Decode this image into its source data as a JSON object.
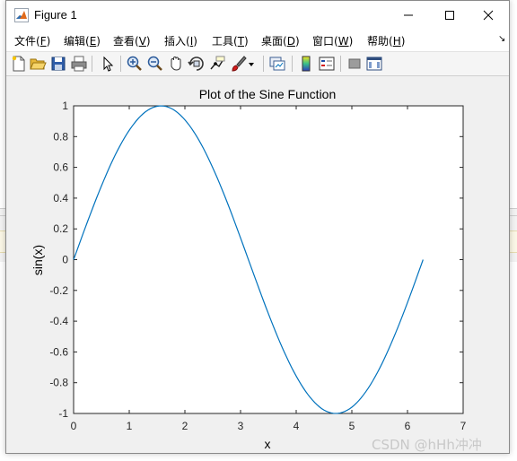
{
  "window": {
    "title": "Figure 1"
  },
  "menu": {
    "items": [
      {
        "label": "文件(F)",
        "text": "文件(",
        "key": "F"
      },
      {
        "label": "编辑(E)",
        "text": "编辑(",
        "key": "E"
      },
      {
        "label": "查看(V)",
        "text": "查看(",
        "key": "V"
      },
      {
        "label": "插入(I)",
        "text": "插入(",
        "key": "I"
      },
      {
        "label": "工具(T)",
        "text": "工具(",
        "key": "T"
      },
      {
        "label": "桌面(D)",
        "text": "桌面(",
        "key": "D"
      },
      {
        "label": "窗口(W)",
        "text": "窗口(",
        "key": "W"
      },
      {
        "label": "帮助(H)",
        "text": "帮助(",
        "key": "H"
      }
    ],
    "dock_icon": "dock-arrow-icon"
  },
  "toolbar": {
    "icons": [
      "new-figure-icon",
      "open-file-icon",
      "save-icon",
      "print-icon",
      "select-pointer-icon",
      "zoom-in-icon",
      "zoom-out-icon",
      "pan-hand-icon",
      "rotate-3d-icon",
      "data-cursor-icon",
      "brush-icon",
      "brush-dropdown-icon",
      "link-plot-icon",
      "insert-colorbar-icon",
      "insert-legend-icon",
      "hide-plot-tools-icon",
      "show-plot-tools-icon"
    ]
  },
  "colors": {
    "line": "#0072BD",
    "figure_bg": "#f0f0f0",
    "axes_bg": "#ffffff"
  },
  "chart_data": {
    "type": "line",
    "title": "Plot of the Sine Function",
    "xlabel": "x",
    "ylabel": "sin(x)",
    "xlim": [
      0,
      7
    ],
    "ylim": [
      -1,
      1
    ],
    "xticks": [
      0,
      1,
      2,
      3,
      4,
      5,
      6,
      7
    ],
    "yticks": [
      -1,
      -0.8,
      -0.6,
      -0.4,
      -0.2,
      0,
      0.2,
      0.4,
      0.6,
      0.8,
      1
    ],
    "ytick_labels": [
      "-1",
      "-0.8",
      "-0.6",
      "-0.4",
      "-0.2",
      "0",
      "0.2",
      "0.4",
      "0.6",
      "0.8",
      "1"
    ],
    "grid": false,
    "series": [
      {
        "x": [
          0,
          0.25,
          0.5,
          0.75,
          1.0,
          1.25,
          1.5,
          1.75,
          2.0,
          2.25,
          2.5,
          2.75,
          3.0,
          3.25,
          3.5,
          3.75,
          4.0,
          4.25,
          4.5,
          4.75,
          5.0,
          5.25,
          5.5,
          5.75,
          6.0,
          6.28
        ],
        "y": [
          0,
          0.247,
          0.479,
          0.682,
          0.841,
          0.949,
          0.997,
          0.984,
          0.909,
          0.778,
          0.598,
          0.382,
          0.141,
          -0.108,
          -0.351,
          -0.572,
          -0.757,
          -0.895,
          -0.978,
          -0.999,
          -0.959,
          -0.859,
          -0.706,
          -0.508,
          -0.279,
          0
        ]
      }
    ]
  },
  "watermark": "CSDN @hHh冲冲"
}
